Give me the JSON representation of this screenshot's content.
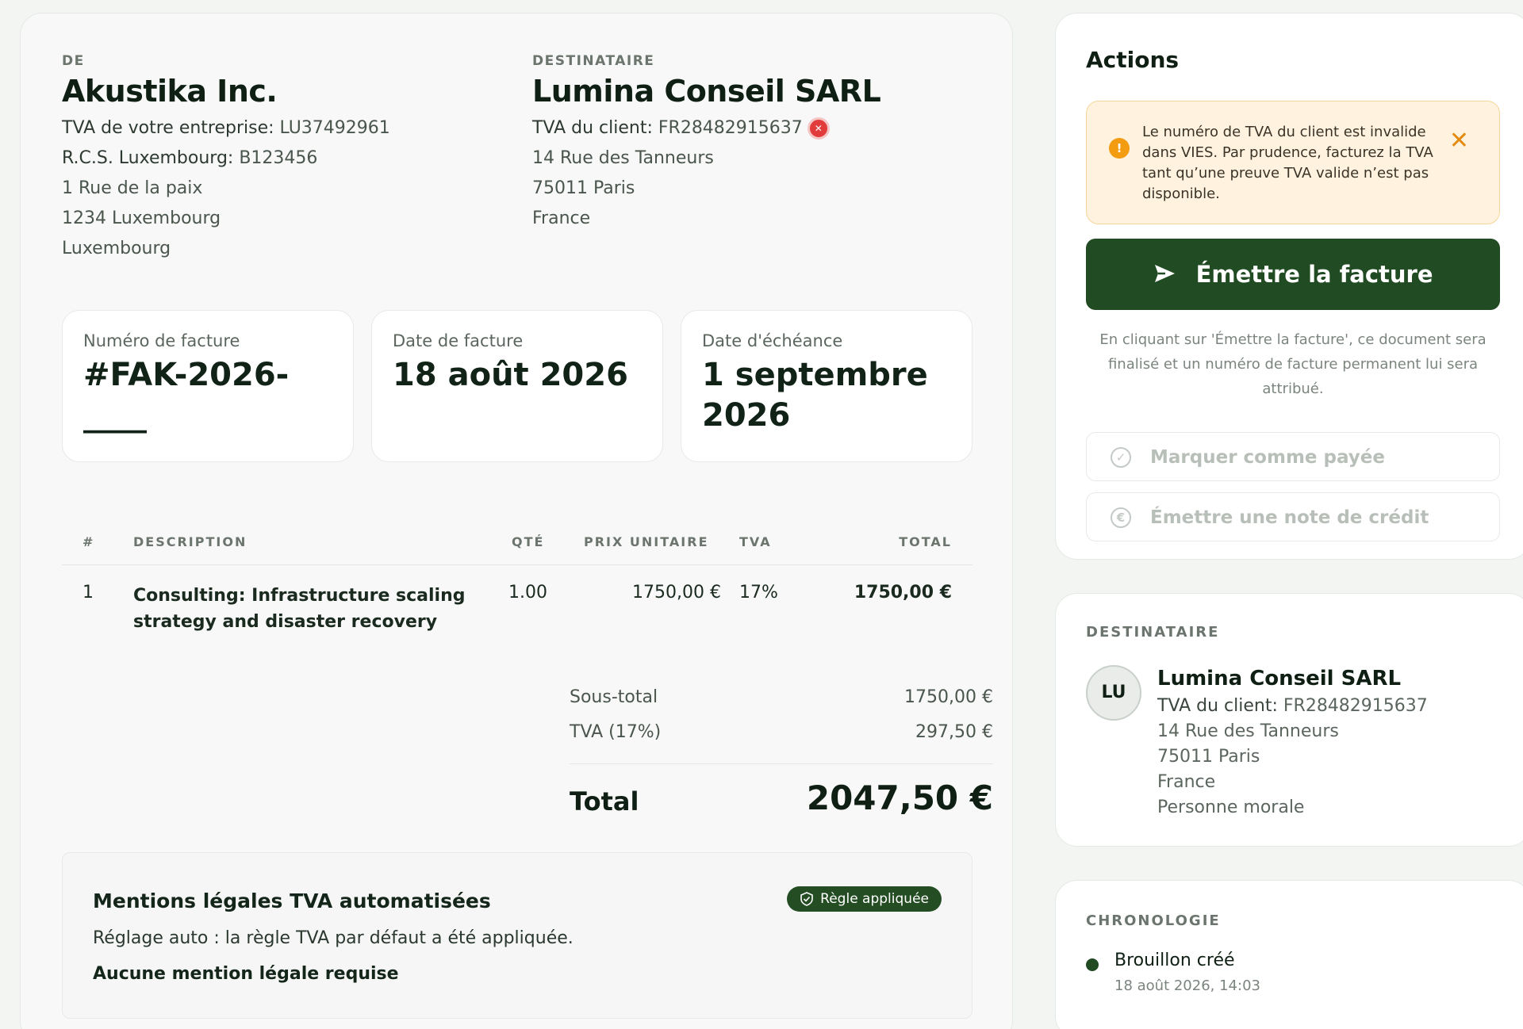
{
  "from": {
    "label": "DE",
    "name": "Akustika Inc.",
    "vat_label": "TVA de votre entreprise:",
    "vat_value": "LU37492961",
    "rcs_label": "R.C.S. Luxembourg:",
    "rcs_value": "B123456",
    "address": [
      "1 Rue de la paix",
      "1234 Luxembourg",
      "Luxembourg"
    ]
  },
  "to": {
    "label": "DESTINATAIRE",
    "name": "Lumina Conseil SARL",
    "vat_label": "TVA du client:",
    "vat_value": "FR28482915637",
    "vat_status_icon": "invalid-x-icon",
    "address": [
      "14 Rue des Tanneurs",
      "75011 Paris",
      "France"
    ]
  },
  "meta": {
    "invoice_number_label": "Numéro de facture",
    "invoice_number": "#FAK-2026-____",
    "invoice_date_label": "Date de facture",
    "invoice_date": "18 août 2026",
    "due_date_label": "Date d'échéance",
    "due_date_line1": "1 septembre",
    "due_date_line2": "2026"
  },
  "table": {
    "headers": {
      "num": "#",
      "description": "DESCRIPTION",
      "qty": "QTÉ",
      "unit_price": "PRIX UNITAIRE",
      "vat": "TVA",
      "total": "TOTAL"
    },
    "rows": [
      {
        "num": "1",
        "description_line1": "Consulting: Infrastructure scaling",
        "description_line2": "strategy and disaster recovery",
        "qty": "1.00",
        "unit_price": "1750,00 €",
        "vat": "17%",
        "total": "1750,00 €"
      }
    ]
  },
  "totals": {
    "subtotal_label": "Sous-total",
    "subtotal_value": "1750,00 €",
    "vat_label": "TVA (17%)",
    "vat_value": "297,50 €",
    "total_label": "Total",
    "total_value": "2047,50 €"
  },
  "legal": {
    "title": "Mentions légales TVA automatisées",
    "badge": "Règle appliquée",
    "text": "Réglage auto : la règle TVA par défaut a été appliquée.",
    "strong": "Aucune mention légale requise"
  },
  "actions": {
    "title": "Actions",
    "warning": "Le numéro de TVA du client est invalide dans VIES. Par prudence, facturez la TVA tant qu’une preuve TVA valide n’est pas disponible.",
    "emit_button": "Émettre la facture",
    "emit_note": "En cliquant sur 'Émettre la facture', ce document sera finalisé et un numéro de facture permanent lui sera attribué.",
    "mark_paid": "Marquer comme payée",
    "credit_note": "Émettre une note de crédit"
  },
  "recipient": {
    "label": "DESTINATAIRE",
    "initials": "LU",
    "name": "Lumina Conseil SARL",
    "vat_label": "TVA du client:",
    "vat_value": "FR28482915637",
    "address": [
      "14 Rue des Tanneurs",
      "75011 Paris",
      "France"
    ],
    "type": "Personne morale"
  },
  "timeline": {
    "label": "CHRONOLOGIE",
    "event_title": "Brouillon créé",
    "event_time": "18 août 2026, 14:03"
  },
  "colors": {
    "brand_green": "#214b22",
    "warning_bg": "#fff3df",
    "warning_accent": "#f39c12",
    "error_red": "#e23b3b"
  }
}
